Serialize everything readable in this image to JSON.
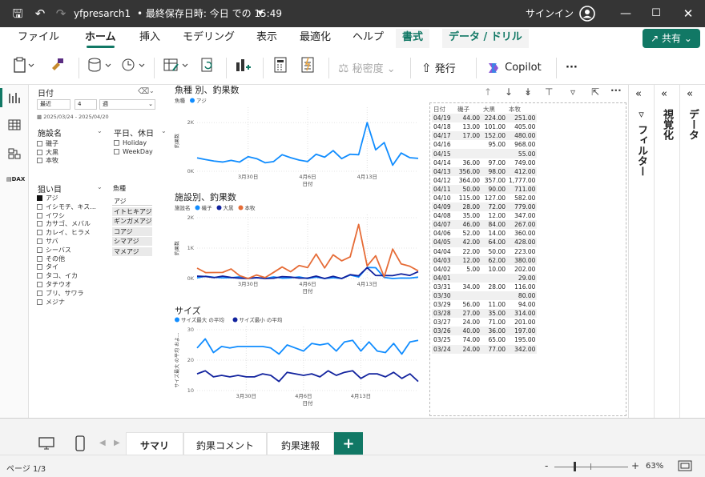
{
  "titlebar": {
    "file_name": "yfpresarch1",
    "save_status": "• 最終保存日時: 今日 での 15:49",
    "signin": "サインイン"
  },
  "menu": {
    "items": [
      "ファイル",
      "ホーム",
      "挿入",
      "モデリング",
      "表示",
      "最適化",
      "ヘルプ",
      "書式",
      "データ / ドリル"
    ],
    "active": "ホーム",
    "share": "共有"
  },
  "ribbon": {
    "sensitivity": "秘密度",
    "publish": "発行",
    "copilot": "Copilot",
    "more": "···"
  },
  "slicers": {
    "date": {
      "title": "日付",
      "mode": "最近",
      "count": "4",
      "unit": "週",
      "range": "2025/03/24 - 2025/04/20"
    },
    "facility": {
      "title": "施設名",
      "items": [
        "磯子",
        "大黒",
        "本牧"
      ]
    },
    "weekday": {
      "title": "平日、休日",
      "items": [
        "Holiday",
        "WeekDay"
      ]
    },
    "target": {
      "title": "狙い目",
      "items": [
        "アジ",
        "イシモチ、キス...",
        "イワシ",
        "カサゴ、メバル",
        "カレイ、ヒラメ",
        "サバ",
        "シーバス",
        "その他",
        "タイ",
        "タコ、イカ",
        "タチウオ",
        "ブリ、サワラ",
        "メジナ"
      ],
      "checked": "アジ"
    },
    "fish": {
      "title": "魚種",
      "items": [
        "アジ",
        "イトヒキアジ",
        "ギンガメアジ",
        "コアジ",
        "シマアジ",
        "マメアジ"
      ]
    }
  },
  "chart_data": [
    {
      "type": "line",
      "title": "魚種 別、釣果数",
      "legend_title": "魚種",
      "xlabel": "日付",
      "ylabel": "釣果数",
      "x_ticks": [
        "3月30日",
        "4月6日",
        "4月13日"
      ],
      "y_ticks": [
        "0K",
        "2K"
      ],
      "ylim": [
        0,
        2500
      ],
      "x": [
        "03/24",
        "03/25",
        "03/26",
        "03/27",
        "03/28",
        "03/29",
        "03/30",
        "03/31",
        "04/01",
        "04/02",
        "04/03",
        "04/04",
        "04/05",
        "04/06",
        "04/07",
        "04/08",
        "04/09",
        "04/10",
        "04/11",
        "04/12",
        "04/13",
        "04/14",
        "04/15",
        "04/16",
        "04/17",
        "04/18",
        "04/19"
      ],
      "series": [
        {
          "name": "アジ",
          "color": "#118DFF",
          "values": [
            550,
            480,
            420,
            380,
            450,
            380,
            600,
            520,
            350,
            400,
            680,
            560,
            460,
            400,
            700,
            580,
            850,
            520,
            700,
            680,
            2000,
            880,
            1180,
            250,
            750,
            560,
            530
          ]
        }
      ]
    },
    {
      "type": "line",
      "title": "施設別、釣果数",
      "legend_title": "施設名",
      "xlabel": "日付",
      "ylabel": "釣果数",
      "x_ticks": [
        "3月30日",
        "4月6日",
        "4月13日"
      ],
      "y_ticks": [
        "0K",
        "1K",
        "2K"
      ],
      "ylim": [
        0,
        2000
      ],
      "x": [
        "03/24",
        "03/25",
        "03/26",
        "03/27",
        "03/28",
        "03/29",
        "03/30",
        "03/31",
        "04/01",
        "04/02",
        "04/03",
        "04/04",
        "04/05",
        "04/06",
        "04/07",
        "04/08",
        "04/09",
        "04/10",
        "04/11",
        "04/12",
        "04/13",
        "04/14",
        "04/15",
        "04/16",
        "04/17",
        "04/18",
        "04/19"
      ],
      "series": [
        {
          "name": "磯子",
          "color": "#118DFF",
          "values": [
            24,
            74,
            40,
            24,
            27,
            56,
            0,
            34,
            0,
            52,
            12,
            22,
            52,
            0,
            46,
            0,
            28,
            0,
            115,
            50,
            364,
            356,
            36,
            0,
            17,
            13,
            44
          ]
        },
        {
          "name": "大黒",
          "color": "#12239E",
          "values": [
            77,
            65,
            30,
            77,
            35,
            11,
            0,
            28,
            0,
            10,
            62,
            50,
            14,
            12,
            80,
            0,
            72,
            0,
            127,
            90,
            357,
            98,
            97,
            95,
            152,
            101,
            224
          ]
        },
        {
          "name": "本牧",
          "color": "#E66C37",
          "values": [
            342,
            195,
            197,
            201,
            314,
            94,
            0,
            116,
            29,
            202,
            380,
            223,
            428,
            360,
            804,
            347,
            779,
            582,
            711,
            1777,
            412,
            749,
            55,
            968,
            480,
            405,
            251
          ]
        }
      ]
    },
    {
      "type": "line",
      "title": "サイズ",
      "xlabel": "日付",
      "ylabel": "サイズ最大 の平均 およ...",
      "x_ticks": [
        "3月30日",
        "4月6日",
        "4月13日"
      ],
      "y_ticks": [
        "10",
        "20",
        "30"
      ],
      "ylim": [
        10,
        30
      ],
      "x": [
        "03/24",
        "03/25",
        "03/26",
        "03/27",
        "03/28",
        "03/29",
        "03/30",
        "03/31",
        "04/01",
        "04/02",
        "04/03",
        "04/04",
        "04/05",
        "04/06",
        "04/07",
        "04/08",
        "04/09",
        "04/10",
        "04/11",
        "04/12",
        "04/13",
        "04/14",
        "04/15",
        "04/16",
        "04/17",
        "04/18",
        "04/19",
        "04/20"
      ],
      "series": [
        {
          "name": "サイズ最大 の平均",
          "color": "#118DFF",
          "values": [
            24,
            27,
            22.5,
            24.5,
            24,
            24.5,
            24.5,
            24.5,
            24.5,
            24,
            22,
            25,
            24,
            23,
            25.5,
            25,
            25.5,
            23,
            26,
            26.5,
            23,
            26,
            23,
            22.5,
            25.5,
            22,
            26,
            26.5
          ]
        },
        {
          "name": "サイズ最小 の平均",
          "color": "#12239E",
          "values": [
            15.5,
            16.5,
            14.5,
            15,
            14.5,
            15,
            14.5,
            14.5,
            15.5,
            15,
            13,
            16,
            15.5,
            15,
            15.5,
            14.5,
            16.5,
            15,
            16,
            16.5,
            14,
            15.5,
            15.5,
            14.5,
            16,
            14,
            15.5,
            13
          ]
        }
      ]
    },
    {
      "type": "table",
      "columns": [
        "日付",
        "磯子",
        "大黒",
        "本牧"
      ],
      "rows": [
        [
          "04/19",
          "44.00",
          "224.00",
          "251.00"
        ],
        [
          "04/18",
          "13.00",
          "101.00",
          "405.00"
        ],
        [
          "04/17",
          "17.00",
          "152.00",
          "480.00"
        ],
        [
          "04/16",
          "",
          "95.00",
          "968.00"
        ],
        [
          "04/15",
          "",
          "",
          "55.00"
        ],
        [
          "04/14",
          "36.00",
          "97.00",
          "749.00"
        ],
        [
          "04/13",
          "356.00",
          "98.00",
          "412.00"
        ],
        [
          "04/12",
          "364.00",
          "357.00",
          "1,777.00"
        ],
        [
          "04/11",
          "50.00",
          "90.00",
          "711.00"
        ],
        [
          "04/10",
          "115.00",
          "127.00",
          "582.00"
        ],
        [
          "04/09",
          "28.00",
          "72.00",
          "779.00"
        ],
        [
          "04/08",
          "35.00",
          "12.00",
          "347.00"
        ],
        [
          "04/07",
          "46.00",
          "84.00",
          "267.00"
        ],
        [
          "04/06",
          "52.00",
          "14.00",
          "360.00"
        ],
        [
          "04/05",
          "42.00",
          "64.00",
          "428.00"
        ],
        [
          "04/04",
          "22.00",
          "50.00",
          "223.00"
        ],
        [
          "04/03",
          "12.00",
          "62.00",
          "380.00"
        ],
        [
          "04/02",
          "5.00",
          "10.00",
          "202.00"
        ],
        [
          "04/01",
          "",
          "",
          "29.00"
        ],
        [
          "03/31",
          "34.00",
          "28.00",
          "116.00"
        ],
        [
          "03/30",
          "",
          "",
          "80.00"
        ],
        [
          "03/29",
          "56.00",
          "11.00",
          "94.00"
        ],
        [
          "03/28",
          "27.00",
          "35.00",
          "314.00"
        ],
        [
          "03/27",
          "24.00",
          "71.00",
          "201.00"
        ],
        [
          "03/26",
          "40.00",
          "36.00",
          "197.00"
        ],
        [
          "03/25",
          "74.00",
          "65.00",
          "195.00"
        ],
        [
          "03/24",
          "24.00",
          "77.00",
          "342.00"
        ]
      ]
    }
  ],
  "panels": {
    "visualize": "視覚化",
    "filter": "フィルター",
    "data": "データ"
  },
  "tabs": {
    "pages": [
      "サマリ",
      "釣果コメント",
      "釣果速報"
    ],
    "active": "サマリ",
    "add": "+"
  },
  "status": {
    "page": "ページ 1/3",
    "zoom": "63%"
  },
  "colors": {
    "accent": "#117865",
    "titlebar": "#353535"
  }
}
